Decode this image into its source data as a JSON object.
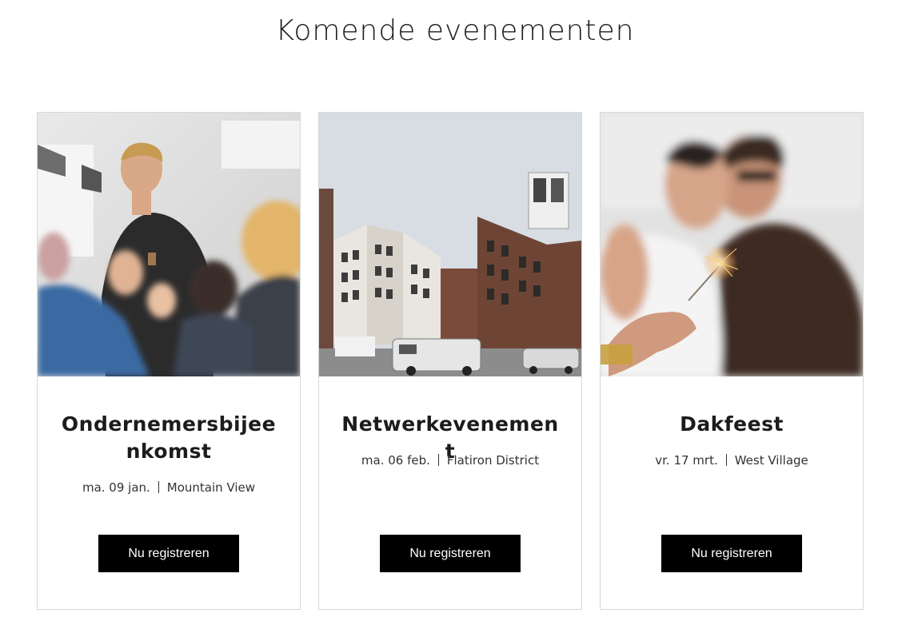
{
  "page": {
    "title": "Komende evenementen"
  },
  "events": [
    {
      "title": "Ondernemersbijeenkomst",
      "date": "ma. 09 jan.",
      "location": "Mountain View",
      "button_label": "Nu registreren",
      "image": "speaker-with-audience-photo"
    },
    {
      "title": "Netwerkevenement",
      "date": "ma. 06 feb.",
      "location": "Flatiron District",
      "button_label": "Nu registreren",
      "image": "city-street-buildings-photo"
    },
    {
      "title": "Dakfeest",
      "date": "vr. 17 mrt.",
      "location": "West Village",
      "button_label": "Nu registreren",
      "image": "people-with-sparkler-photo"
    }
  ],
  "colors": {
    "button_bg": "#000000",
    "button_text": "#ffffff",
    "card_border": "#d8d8d8"
  }
}
